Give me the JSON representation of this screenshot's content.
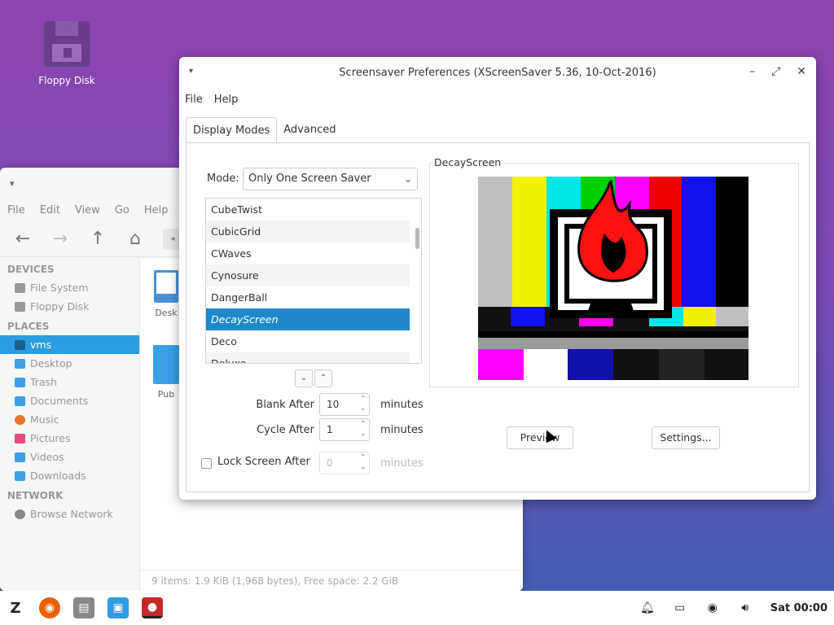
{
  "desktop": {
    "icon_label": "Floppy Disk"
  },
  "file_manager": {
    "menu": [
      "File",
      "Edit",
      "View",
      "Go",
      "Help"
    ],
    "sections": {
      "devices": "DEVICES",
      "places": "PLACES",
      "network": "NETWORK"
    },
    "devices": [
      "File System",
      "Floppy Disk"
    ],
    "places": [
      "vms",
      "Desktop",
      "Trash",
      "Documents",
      "Music",
      "Pictures",
      "Videos",
      "Downloads"
    ],
    "network": [
      "Browse Network"
    ],
    "files": [
      "Desk",
      "Pub"
    ],
    "status": "9 items: 1.9 KiB (1,968 bytes), Free space: 2.2 GiB"
  },
  "xscreensaver": {
    "title": "Screensaver Preferences (XScreenSaver 5.36, 10-Oct-2016)",
    "menu": {
      "file": "File",
      "help": "Help"
    },
    "tabs": {
      "display": "Display Modes",
      "advanced": "Advanced"
    },
    "mode_label": "Mode:",
    "mode_value": "Only One Screen Saver",
    "list": [
      "CubeTwist",
      "CubicGrid",
      "CWaves",
      "Cynosure",
      "DangerBall",
      "DecayScreen",
      "Deco",
      "Deluxe"
    ],
    "selected": "DecayScreen",
    "blank_after_label": "Blank After",
    "blank_after_value": "10",
    "cycle_after_label": "Cycle After",
    "cycle_after_value": "1",
    "lock_label": "Lock Screen After",
    "lock_value": "0",
    "unit": "minutes",
    "preview_caption": "DecayScreen",
    "preview_button": "Preview",
    "settings_button": "Settings..."
  },
  "taskbar": {
    "clock": "Sat 00:00"
  }
}
